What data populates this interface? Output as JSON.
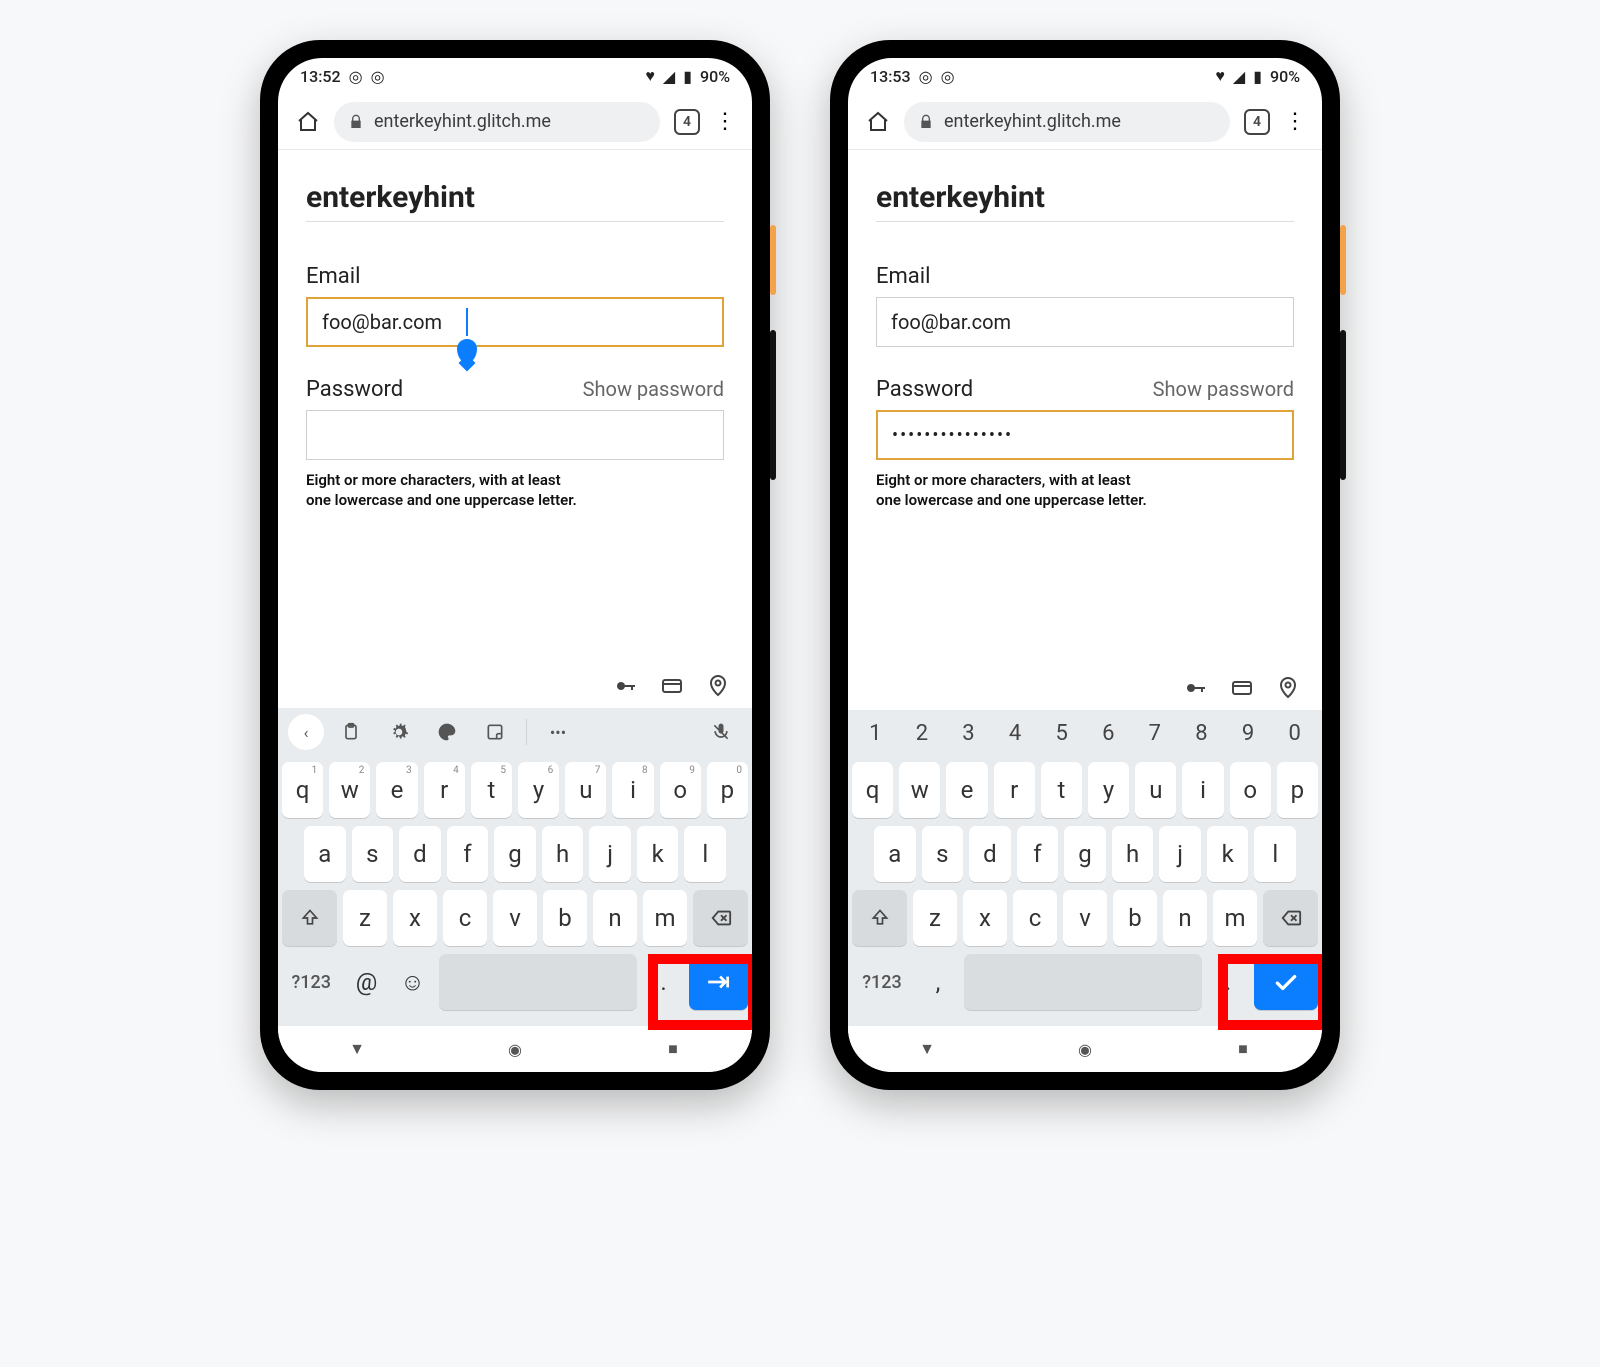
{
  "phones": [
    {
      "status": {
        "time": "13:52",
        "battery": "90%"
      },
      "browser": {
        "url": "enterkeyhint.glitch.me",
        "tab_count": "4"
      },
      "page": {
        "title": "enterkeyhint",
        "email_label": "Email",
        "email_value": "foo@bar.com",
        "email_focused": true,
        "password_label": "Password",
        "show_password": "Show password",
        "password_value": "",
        "password_focused": false,
        "hint_line1": "Eight or more characters, with at least",
        "hint_line2": "one lowercase and one uppercase letter."
      },
      "keyboard": {
        "has_toolbar": true,
        "has_numrow": false,
        "sym_label": "?123",
        "extra_key": "@",
        "period_key": ".",
        "enter_icon": "next",
        "row1_sup": true
      }
    },
    {
      "status": {
        "time": "13:53",
        "battery": "90%"
      },
      "browser": {
        "url": "enterkeyhint.glitch.me",
        "tab_count": "4"
      },
      "page": {
        "title": "enterkeyhint",
        "email_label": "Email",
        "email_value": "foo@bar.com",
        "email_focused": false,
        "password_label": "Password",
        "show_password": "Show password",
        "password_value": "•••••••••••••••",
        "password_focused": true,
        "hint_line1": "Eight or more characters, with at least",
        "hint_line2": "one lowercase and one uppercase letter."
      },
      "keyboard": {
        "has_toolbar": false,
        "has_numrow": true,
        "sym_label": "?123",
        "extra_key": ",",
        "period_key": ".",
        "enter_icon": "done",
        "row1_sup": false
      }
    }
  ],
  "keys": {
    "numrow": [
      "1",
      "2",
      "3",
      "4",
      "5",
      "6",
      "7",
      "8",
      "9",
      "0"
    ],
    "row1": [
      "q",
      "w",
      "e",
      "r",
      "t",
      "y",
      "u",
      "i",
      "o",
      "p"
    ],
    "row1_sup": [
      "1",
      "2",
      "3",
      "4",
      "5",
      "6",
      "7",
      "8",
      "9",
      "0"
    ],
    "row2": [
      "a",
      "s",
      "d",
      "f",
      "g",
      "h",
      "j",
      "k",
      "l"
    ],
    "row3": [
      "z",
      "x",
      "c",
      "v",
      "b",
      "n",
      "m"
    ]
  }
}
